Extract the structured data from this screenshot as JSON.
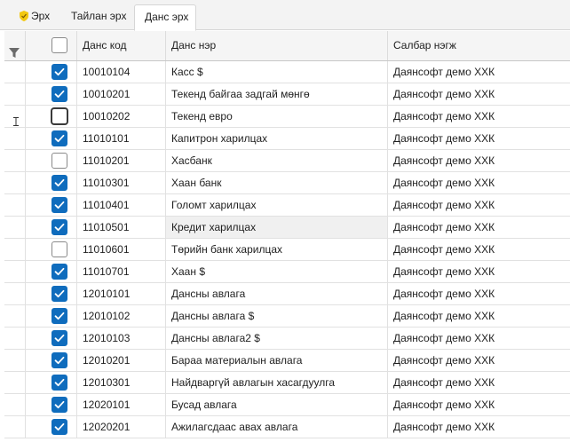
{
  "tabs": [
    {
      "label": "Эрх",
      "icon": "shield-icon",
      "active": false
    },
    {
      "label": "Тайлан эрх",
      "active": false
    },
    {
      "label": "Данс эрх",
      "active": true
    }
  ],
  "grid": {
    "columns": {
      "code": "Данс код",
      "name": "Данс нэр",
      "branch": "Салбар нэгж"
    },
    "filter_icon": "filter-icon",
    "header_checkbox_checked": false,
    "rows": [
      {
        "checked": true,
        "code": "10010104",
        "name": "Касс $",
        "branch": "Даянсофт демо ХХК"
      },
      {
        "checked": true,
        "code": "10010201",
        "name": "Текенд байгаа задгай мөнгө",
        "branch": "Даянсофт демо ХХК"
      },
      {
        "checked": false,
        "code": "10010202",
        "name": "Текенд евро",
        "branch": "Даянсофт демо ХХК"
      },
      {
        "checked": true,
        "code": "11010101",
        "name": "Капитрон харилцах",
        "branch": "Даянсофт демо ХХК"
      },
      {
        "checked": false,
        "code": "11010201",
        "name": "Хасбанк",
        "branch": "Даянсофт демо ХХК"
      },
      {
        "checked": true,
        "code": "11010301",
        "name": "Хаан банк",
        "branch": "Даянсофт демо ХХК"
      },
      {
        "checked": true,
        "code": "11010401",
        "name": "Голомт харилцах",
        "branch": "Даянсофт демо ХХК"
      },
      {
        "checked": true,
        "code": "11010501",
        "name": "Кредит харилцах",
        "branch": "Даянсофт демо ХХК"
      },
      {
        "checked": false,
        "code": "11010601",
        "name": "Төрийн банк харилцах",
        "branch": "Даянсофт демо ХХК"
      },
      {
        "checked": true,
        "code": "11010701",
        "name": "Хаан $",
        "branch": "Даянсофт демо ХХК"
      },
      {
        "checked": true,
        "code": "12010101",
        "name": "Дансны авлага",
        "branch": "Даянсофт демо ХХК"
      },
      {
        "checked": true,
        "code": "12010102",
        "name": "Дансны авлага $",
        "branch": "Даянсофт демо ХХК"
      },
      {
        "checked": true,
        "code": "12010103",
        "name": "Дансны авлага2 $",
        "branch": "Даянсофт демо ХХК"
      },
      {
        "checked": true,
        "code": "12010201",
        "name": "Бараа материалын авлага",
        "branch": "Даянсофт демо ХХК"
      },
      {
        "checked": true,
        "code": "12010301",
        "name": "Найдваргүй авлагын хасагдуулга",
        "branch": "Даянсофт демо ХХК"
      },
      {
        "checked": true,
        "code": "12020101",
        "name": "Бусад авлага",
        "branch": "Даянсофт демо ХХК"
      },
      {
        "checked": true,
        "code": "12020201",
        "name": "Ажилагсдаас авах авлага",
        "branch": "Даянсофт демо ХХК"
      }
    ]
  },
  "colors": {
    "accent": "#0f6cbd",
    "shield": "#f2c811"
  }
}
